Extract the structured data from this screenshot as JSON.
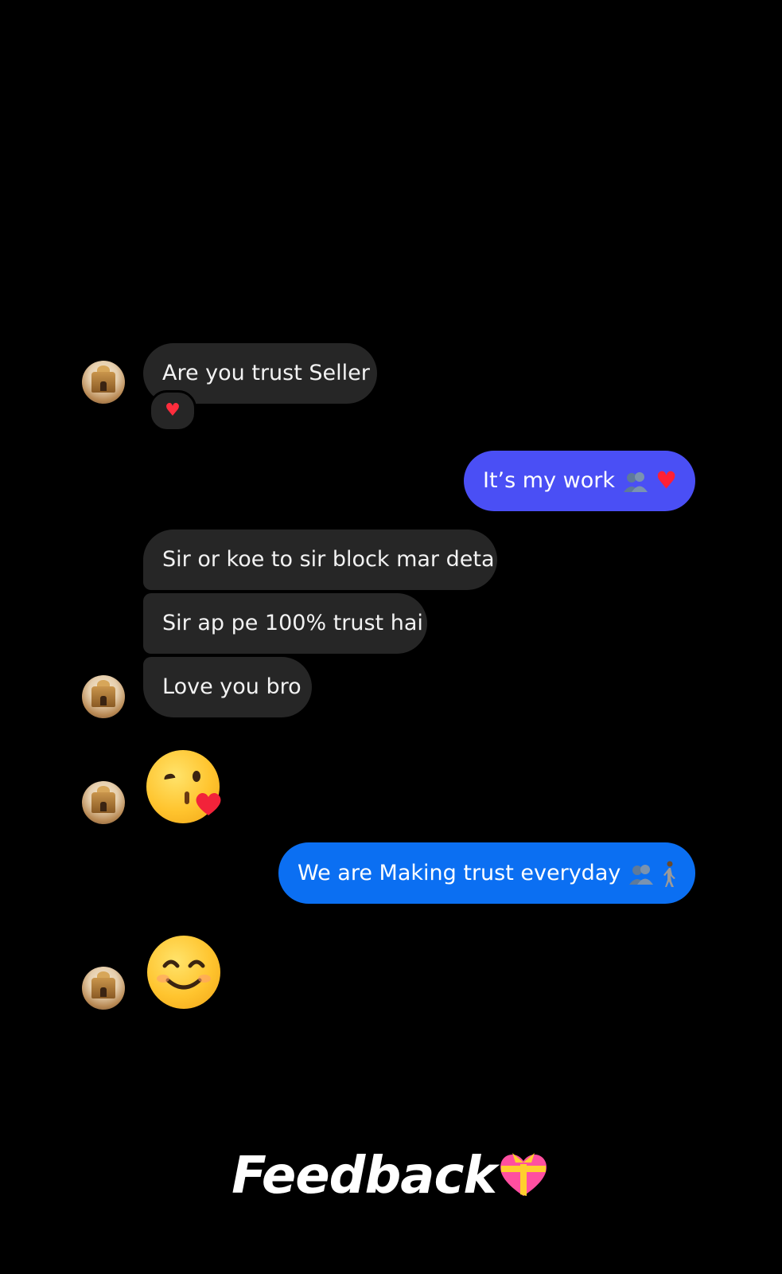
{
  "messages": {
    "m1": {
      "text": "Are you trust Seller",
      "reaction": "♥"
    },
    "m2": {
      "text": "It’s my work",
      "trail": "♥"
    },
    "m3": {
      "text": "Sir or koe to sir block mar deta"
    },
    "m4": {
      "text": "Sir ap pe 100% trust hai"
    },
    "m5": {
      "text": "Love you bro"
    },
    "m6": {
      "text": "We are Making trust everyday"
    }
  },
  "footer": {
    "title": "Feedback",
    "icon": "♥"
  },
  "colors": {
    "incoming_bubble": "#262626",
    "outgoing_gradient_top": "#4b4cf5",
    "outgoing_gradient_bottom": "#0a6ff5",
    "background": "#000000"
  },
  "icons": {
    "avatar": "temple-avatar-icon",
    "kiss": "face-blowing-kiss-icon",
    "smile": "smiling-face-icon",
    "people": "busts-icon",
    "walker": "person-walking-icon"
  }
}
